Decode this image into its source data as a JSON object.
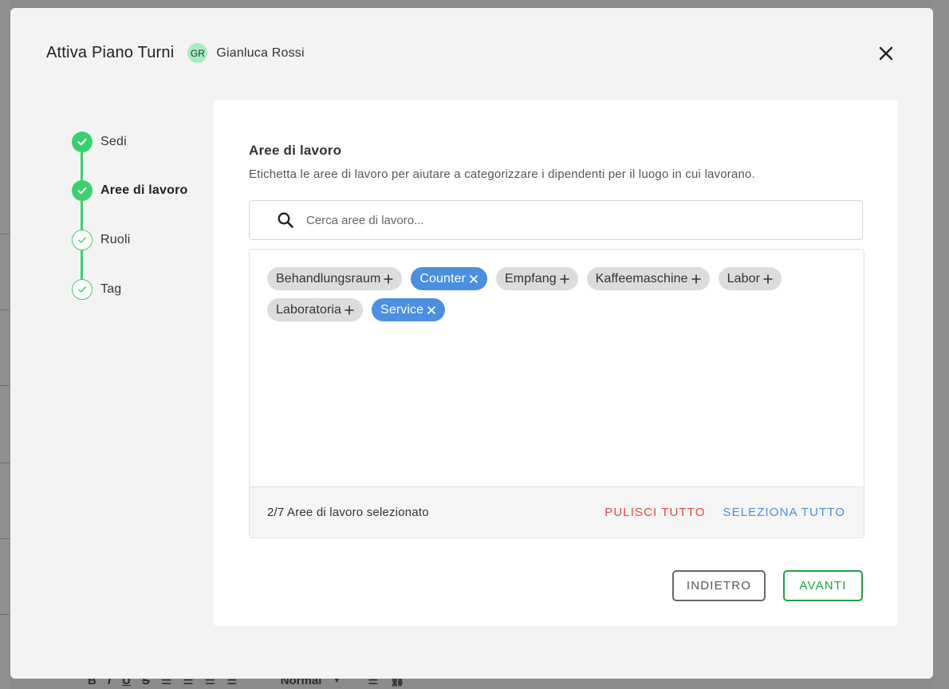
{
  "modal": {
    "title": "Attiva Piano Turni",
    "user": {
      "initials": "GR",
      "name": "Gianluca Rossi"
    }
  },
  "stepper": {
    "steps": [
      {
        "label": "Sedi",
        "state": "done"
      },
      {
        "label": "Aree di lavoro",
        "state": "active"
      },
      {
        "label": "Ruoli",
        "state": "todo"
      },
      {
        "label": "Tag",
        "state": "todo"
      }
    ]
  },
  "content": {
    "title": "Aree di lavoro",
    "subtitle": "Etichetta le aree di lavoro per aiutare a categorizzare i dipendenti per il luogo in cui lavorano.",
    "search": {
      "placeholder": "Cerca aree di lavoro...",
      "value": ""
    },
    "tags": [
      {
        "label": "Behandlungsraum",
        "selected": false
      },
      {
        "label": "Counter",
        "selected": true
      },
      {
        "label": "Empfang",
        "selected": false
      },
      {
        "label": "Kaffeemaschine",
        "selected": false
      },
      {
        "label": "Labor",
        "selected": false
      },
      {
        "label": "Laboratoria",
        "selected": false
      },
      {
        "label": "Service",
        "selected": true
      }
    ],
    "footer": {
      "count_text": "2/7 Aree di lavoro selezionato",
      "clear_all": "PULISCI TUTTO",
      "select_all": "SELEZIONA TUTTO"
    }
  },
  "actions": {
    "back": "INDIETRO",
    "next": "AVANTI"
  },
  "background": {
    "toolbar_style": "Normal"
  },
  "colors": {
    "accent_green": "#3ccf6e",
    "selected_blue": "#4a8fe0",
    "danger_red": "#e84545",
    "next_green": "#1ea043"
  }
}
